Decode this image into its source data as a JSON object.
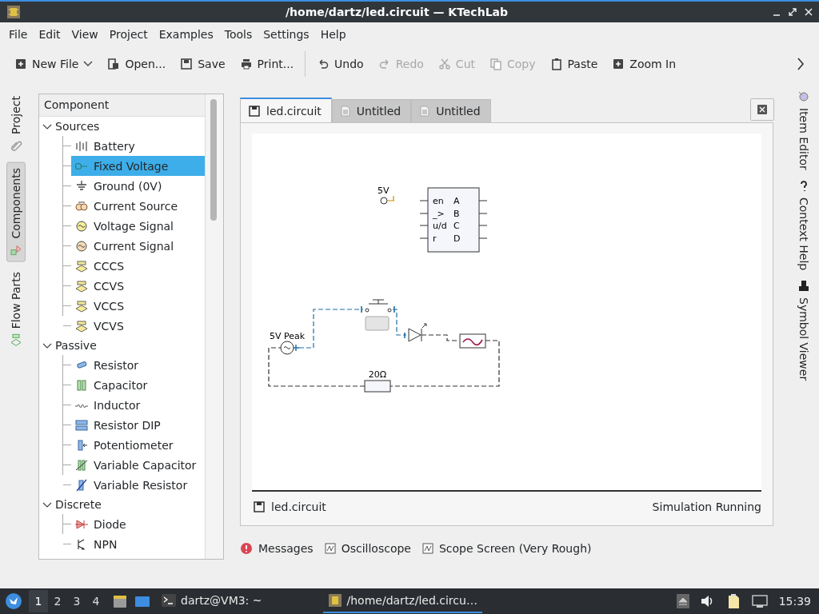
{
  "window": {
    "title": "/home/dartz/led.circuit — KTechLab"
  },
  "menu": [
    "File",
    "Edit",
    "View",
    "Project",
    "Examples",
    "Tools",
    "Settings",
    "Help"
  ],
  "toolbar": {
    "groups": [
      [
        {
          "label": "New File",
          "kind": "split",
          "disabled": false
        },
        {
          "label": "Open...",
          "kind": "button",
          "disabled": false
        },
        {
          "label": "Save",
          "kind": "button",
          "disabled": false
        },
        {
          "label": "Print...",
          "kind": "button",
          "disabled": false
        }
      ],
      [
        {
          "label": "Undo",
          "kind": "button",
          "disabled": false
        },
        {
          "label": "Redo",
          "kind": "button",
          "disabled": true
        },
        {
          "label": "Cut",
          "kind": "button",
          "disabled": true
        },
        {
          "label": "Copy",
          "kind": "button",
          "disabled": true
        },
        {
          "label": "Paste",
          "kind": "button",
          "disabled": false
        },
        {
          "label": "Zoom In",
          "kind": "button",
          "disabled": false
        }
      ]
    ]
  },
  "left_dock": [
    {
      "label": "Project",
      "selected": false
    },
    {
      "label": "Components",
      "selected": true
    },
    {
      "label": "Flow Parts",
      "selected": false
    }
  ],
  "component_tree": {
    "header": "Component",
    "groups": [
      {
        "label": "Sources",
        "expanded": true,
        "children": [
          {
            "label": "Battery",
            "selected": false
          },
          {
            "label": "Fixed Voltage",
            "selected": true
          },
          {
            "label": "Ground (0V)",
            "selected": false
          },
          {
            "label": "Current Source",
            "selected": false
          },
          {
            "label": "Voltage Signal",
            "selected": false
          },
          {
            "label": "Current Signal",
            "selected": false
          },
          {
            "label": "CCCS",
            "selected": false
          },
          {
            "label": "CCVS",
            "selected": false
          },
          {
            "label": "VCCS",
            "selected": false
          },
          {
            "label": "VCVS",
            "selected": false
          }
        ]
      },
      {
        "label": "Passive",
        "expanded": true,
        "children": [
          {
            "label": "Resistor",
            "selected": false
          },
          {
            "label": "Capacitor",
            "selected": false
          },
          {
            "label": "Inductor",
            "selected": false
          },
          {
            "label": "Resistor DIP",
            "selected": false
          },
          {
            "label": "Potentiometer",
            "selected": false
          },
          {
            "label": "Variable Capacitor",
            "selected": false
          },
          {
            "label": "Variable Resistor",
            "selected": false
          }
        ]
      },
      {
        "label": "Discrete",
        "expanded": true,
        "children": [
          {
            "label": "Diode",
            "selected": false
          },
          {
            "label": "NPN",
            "selected": false
          }
        ]
      }
    ]
  },
  "documents": {
    "tabs": [
      {
        "label": "led.circuit",
        "kind": "saved",
        "selected": true
      },
      {
        "label": "Untitled",
        "kind": "text",
        "selected": false
      },
      {
        "label": "Untitled",
        "kind": "text",
        "selected": false
      }
    ],
    "canvas": {
      "supply_label": "5V",
      "counter_inputs": [
        "en",
        "_>",
        "u/d",
        "r"
      ],
      "counter_outputs": [
        "A",
        "B",
        "C",
        "D"
      ],
      "source_label": "5V Peak",
      "resistor_label": "20Ω"
    },
    "status": {
      "file": "led.circuit",
      "state": "Simulation Running"
    }
  },
  "bottom_tabs": [
    {
      "label": "Messages",
      "kind": "messages"
    },
    {
      "label": "Oscilloscope",
      "kind": "scope"
    },
    {
      "label": "Scope Screen (Very Rough)",
      "kind": "scope"
    }
  ],
  "right_dock": [
    {
      "label": "Item Editor"
    },
    {
      "label": "Context Help"
    },
    {
      "label": "Symbol Viewer"
    }
  ],
  "taskbar": {
    "workspaces": [
      {
        "label": "1",
        "selected": true
      },
      {
        "label": "2",
        "selected": false
      },
      {
        "label": "3",
        "selected": false
      },
      {
        "label": "4",
        "selected": false
      }
    ],
    "tasks": [
      {
        "label": "dartz@VM3: ~",
        "kind": "terminal",
        "selected": false
      },
      {
        "label": "/home/dartz/led.circu…",
        "kind": "app",
        "selected": true
      }
    ],
    "clock": "15:39"
  }
}
